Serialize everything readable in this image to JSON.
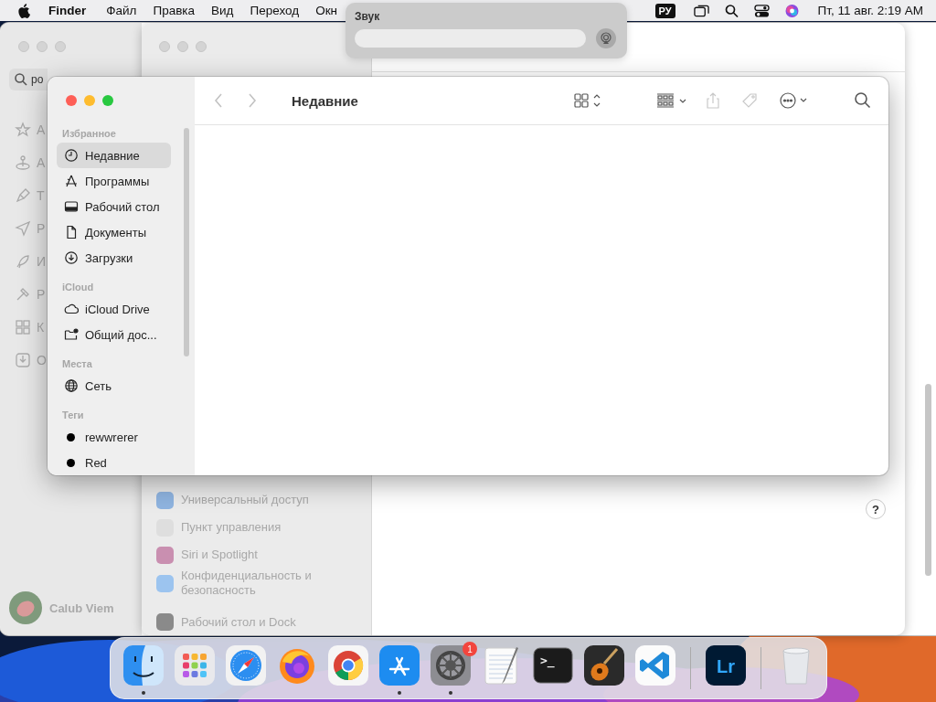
{
  "menu_bar": {
    "app": "Finder",
    "menus": [
      "Файл",
      "Правка",
      "Вид",
      "Переход",
      "Окн"
    ],
    "input_source": "РУ",
    "datetime": "Пт, 11 авг.  2:19 AM"
  },
  "sound_popup": {
    "title": "Звук",
    "level": 0
  },
  "back_window": {
    "search": {
      "value": "ро"
    },
    "sidebar_items": [
      {
        "kind": "star",
        "label": "А"
      },
      {
        "kind": "joystick",
        "label": "А"
      },
      {
        "kind": "brush",
        "label": "Т"
      },
      {
        "kind": "plane",
        "label": "Р"
      },
      {
        "kind": "rocket",
        "label": "И"
      },
      {
        "kind": "hammer",
        "label": "Р"
      },
      {
        "kind": "grid",
        "label": "К"
      },
      {
        "kind": "tray",
        "label": "О"
      }
    ],
    "user": "Calub Viem"
  },
  "settings_window": {
    "sidebar_items": [
      {
        "label": "Универсальный доступ",
        "color": "#8fb4e0"
      },
      {
        "label": "Пункт управления",
        "color": "#dedede"
      },
      {
        "label": "Siri и Spotlight",
        "color": "#c98fb0"
      },
      {
        "label": "Конфиденциальность и безопасность",
        "color": "#9cc4ef"
      },
      {
        "label": "Рабочий стол и Dock",
        "color": "#8a8a8a"
      }
    ],
    "help": "?"
  },
  "finder": {
    "title": "Недавние",
    "nav": [
      {
        "kind": "back",
        "disabled": true
      },
      {
        "kind": "forward",
        "disabled": true
      }
    ],
    "toolbar": [
      {
        "kind": "view",
        "disabled": false
      },
      {
        "kind": "group",
        "disabled": false
      },
      {
        "kind": "share",
        "disabled": true
      },
      {
        "kind": "tags",
        "disabled": true
      },
      {
        "kind": "more",
        "disabled": false
      },
      {
        "kind": "search",
        "disabled": false
      }
    ],
    "sidebar": [
      {
        "heading": "Избранное",
        "items": [
          {
            "kind": "clock",
            "label": "Недавние",
            "selected": true
          },
          {
            "kind": "apps",
            "label": "Программы",
            "selected": false
          },
          {
            "kind": "desktop",
            "label": "Рабочий стол",
            "selected": false
          },
          {
            "kind": "doc",
            "label": "Документы",
            "selected": false
          },
          {
            "kind": "download",
            "label": "Загрузки",
            "selected": false
          }
        ]
      },
      {
        "heading": "iCloud",
        "items": [
          {
            "kind": "cloud",
            "label": "iCloud Drive",
            "selected": false
          },
          {
            "kind": "shared",
            "label": "Общий дос...",
            "selected": false
          }
        ]
      },
      {
        "heading": "Места",
        "items": [
          {
            "kind": "globe",
            "label": "Сеть",
            "selected": false
          }
        ]
      },
      {
        "heading": "Теги",
        "items": [
          {
            "kind": "tag",
            "label": "rewwrerer",
            "color": "#000000",
            "selected": false
          },
          {
            "kind": "tag",
            "label": "Red",
            "color": "#000000",
            "selected": false
          }
        ]
      }
    ]
  },
  "dock": {
    "items": [
      {
        "kind": "finder",
        "running": true
      },
      {
        "kind": "launchpad",
        "running": false
      },
      {
        "kind": "safari",
        "running": false
      },
      {
        "kind": "firefox",
        "running": false
      },
      {
        "kind": "chrome",
        "running": false
      },
      {
        "kind": "appstore",
        "running": true
      },
      {
        "kind": "settings",
        "running": true,
        "badge": "1"
      },
      {
        "kind": "textedit",
        "running": false
      },
      {
        "kind": "terminal",
        "running": false,
        "label": ">_"
      },
      {
        "kind": "garageband",
        "running": false
      },
      {
        "kind": "vscode",
        "running": false
      },
      {
        "kind": "separator"
      },
      {
        "kind": "lightroom",
        "running": false,
        "label": "Lr"
      },
      {
        "kind": "separator"
      },
      {
        "kind": "trash",
        "running": false
      }
    ]
  }
}
